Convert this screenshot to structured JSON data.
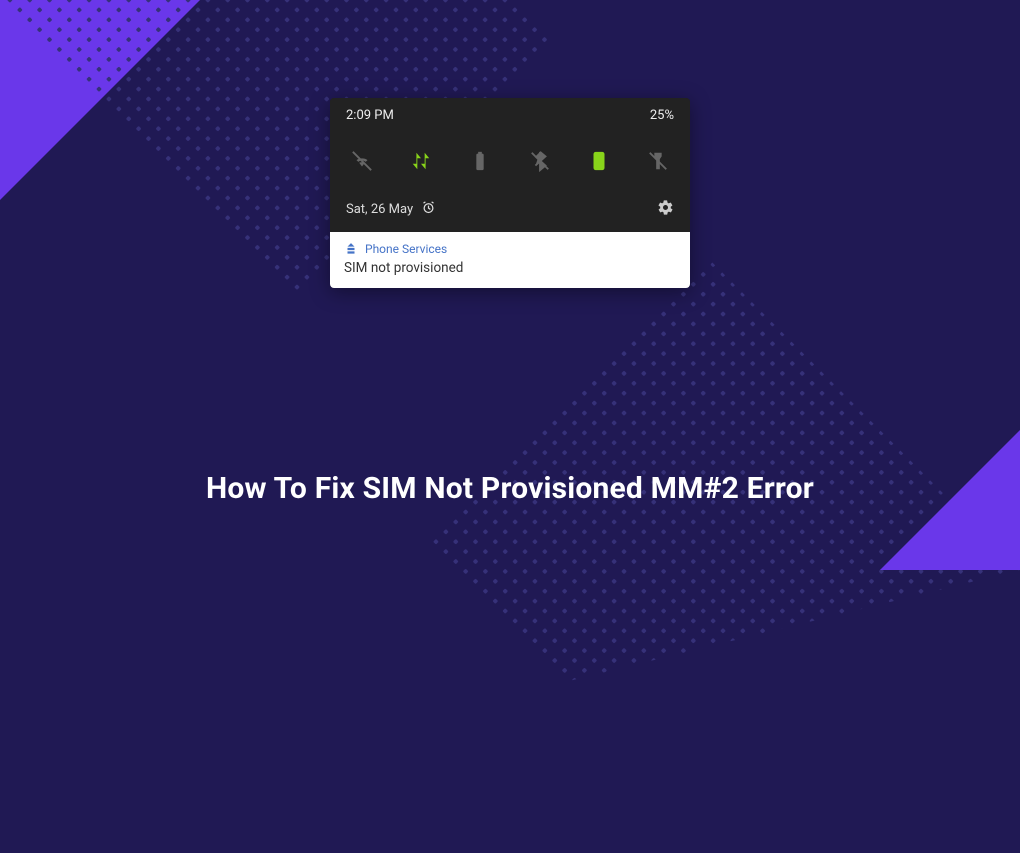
{
  "colors": {
    "background": "#201954",
    "accent": "#6a37ea",
    "dot": "#363179",
    "active_green": "#88d41a",
    "muted_gray": "#666666",
    "notif_blue": "#4573c7"
  },
  "status_bar": {
    "time": "2:09 PM",
    "battery_percent": "25%"
  },
  "quick_settings": {
    "tiles": [
      {
        "name": "wifi-off-icon",
        "active": false
      },
      {
        "name": "mobile-data-icon",
        "active": true
      },
      {
        "name": "battery-saver-icon",
        "active": false
      },
      {
        "name": "bluetooth-off-icon",
        "active": false
      },
      {
        "name": "portrait-icon",
        "active": true
      },
      {
        "name": "flashlight-off-icon",
        "active": false
      }
    ]
  },
  "date_row": {
    "date": "Sat, 26 May",
    "alarm_set": true
  },
  "notification": {
    "app_name": "Phone Services",
    "message": "SIM not provisioned"
  },
  "headline": "How To Fix SIM Not Provisioned MM#2 Error"
}
